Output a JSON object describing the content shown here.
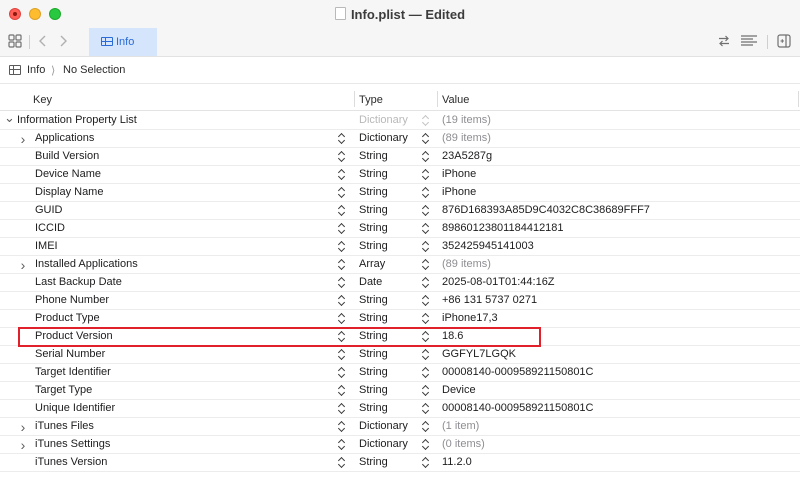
{
  "window": {
    "title": "Info.plist — Edited"
  },
  "toolbar": {
    "tab_label": "Info"
  },
  "breadcrumb": {
    "root": "Info",
    "separator": "⟩",
    "selection": "No Selection"
  },
  "columns": {
    "key": "Key",
    "type": "Type",
    "value": "Value"
  },
  "rows": [
    {
      "key": "Information Property List",
      "type": "Dictionary",
      "value": "(19 items)",
      "disclosure": "expanded",
      "root": true
    },
    {
      "key": "Applications",
      "type": "Dictionary",
      "value": "(89 items)",
      "disclosure": "collapsed"
    },
    {
      "key": "Build Version",
      "type": "String",
      "value": "23A5287g"
    },
    {
      "key": "Device Name",
      "type": "String",
      "value": "iPhone"
    },
    {
      "key": "Display Name",
      "type": "String",
      "value": "iPhone"
    },
    {
      "key": "GUID",
      "type": "String",
      "value": "876D168393A85D9C4032C8C38689FFF7"
    },
    {
      "key": "ICCID",
      "type": "String",
      "value": "89860123801184412181"
    },
    {
      "key": "IMEI",
      "type": "String",
      "value": "352425945141003"
    },
    {
      "key": "Installed Applications",
      "type": "Array",
      "value": "(89 items)",
      "disclosure": "collapsed"
    },
    {
      "key": "Last Backup Date",
      "type": "Date",
      "value": "2025-08-01T01:44:16Z"
    },
    {
      "key": "Phone Number",
      "type": "String",
      "value": "+86 131 5737 0271"
    },
    {
      "key": "Product Type",
      "type": "String",
      "value": "iPhone17,3"
    },
    {
      "key": "Product Version",
      "type": "String",
      "value": "18.6",
      "highlighted": true
    },
    {
      "key": "Serial Number",
      "type": "String",
      "value": "GGFYL7LGQK"
    },
    {
      "key": "Target Identifier",
      "type": "String",
      "value": "00008140-000958921150801C"
    },
    {
      "key": "Target Type",
      "type": "String",
      "value": "Device"
    },
    {
      "key": "Unique Identifier",
      "type": "String",
      "value": "00008140-000958921150801C"
    },
    {
      "key": "iTunes Files",
      "type": "Dictionary",
      "value": "(1 item)",
      "disclosure": "collapsed"
    },
    {
      "key": "iTunes Settings",
      "type": "Dictionary",
      "value": "(0 items)",
      "disclosure": "collapsed"
    },
    {
      "key": "iTunes Version",
      "type": "String",
      "value": "11.2.0"
    }
  ],
  "colors": {
    "accent": "#2a6bd8",
    "tab_bg": "#d5e5fb",
    "highlight_border": "#e0202b"
  }
}
